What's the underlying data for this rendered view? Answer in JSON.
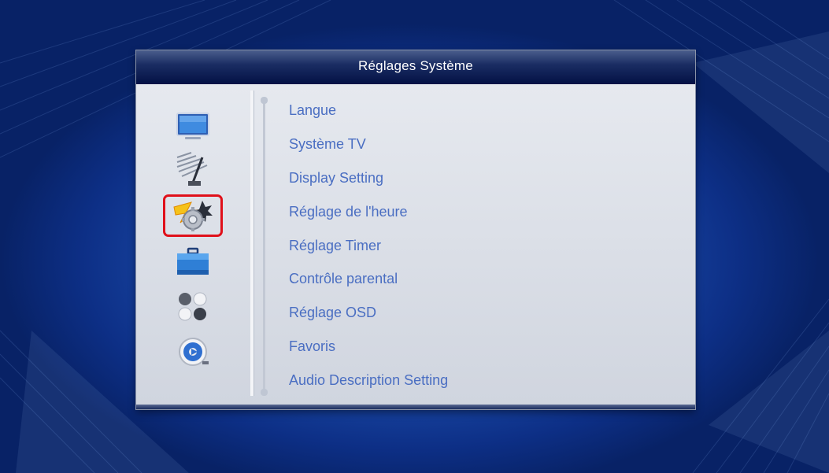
{
  "window": {
    "title": "Réglages Système"
  },
  "sidebar": {
    "icons": [
      {
        "name": "tv-icon",
        "selected": false
      },
      {
        "name": "satellite-dish-icon",
        "selected": false
      },
      {
        "name": "system-settings-gear-icon",
        "selected": true
      },
      {
        "name": "toolbox-icon",
        "selected": false
      },
      {
        "name": "apps-icon",
        "selected": false
      },
      {
        "name": "media-player-icon",
        "selected": false
      }
    ]
  },
  "menu": {
    "items": [
      {
        "label": "Langue"
      },
      {
        "label": "Système TV"
      },
      {
        "label": "Display Setting"
      },
      {
        "label": "Réglage de l'heure"
      },
      {
        "label": "Réglage Timer"
      },
      {
        "label": "Contrôle parental"
      },
      {
        "label": "Réglage OSD"
      },
      {
        "label": "Favoris"
      },
      {
        "label": "Audio Description Setting"
      }
    ]
  },
  "colors": {
    "menu_text": "#4a6ec2",
    "selection_border": "#e0101a",
    "title_bar": "#0a1a55",
    "panel_bg": "#d7dce6"
  }
}
